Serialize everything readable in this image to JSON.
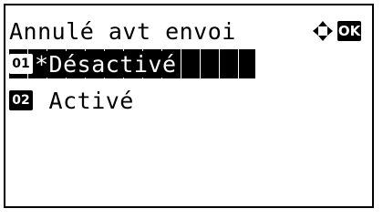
{
  "screen": {
    "title": "Annulé avt envoi",
    "ok_label": "OK"
  },
  "icons": {
    "nav": "four-way-arrows-icon",
    "ok": "ok-key-icon"
  },
  "options": [
    {
      "number": "01",
      "label": "*Désactivé",
      "selected": true
    },
    {
      "number": "02",
      "label": " Activé",
      "selected": false
    }
  ],
  "colors": {
    "foreground": "#000000",
    "background": "#ffffff"
  }
}
